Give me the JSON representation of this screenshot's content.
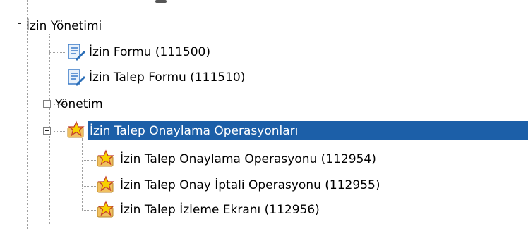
{
  "tree": {
    "root": {
      "label": "İzin Yönetimi",
      "icon": "collapse-icon",
      "children": [
        {
          "label": "İzin Formu (111500)",
          "icon": "form-edit-icon"
        },
        {
          "label": "İzin Talep Formu (111510)",
          "icon": "form-edit-icon"
        },
        {
          "label": "Yönetim",
          "icon": "expand-icon"
        },
        {
          "label": "İzin Talep Onaylama Operasyonları",
          "icon": "star-folder-icon",
          "selected": true,
          "children": [
            {
              "label": "İzin Talep Onaylama Operasyonu (112954)",
              "icon": "star-folder-icon"
            },
            {
              "label": "İzin Talep Onay İptali Operasyonu (112955)",
              "icon": "star-folder-icon"
            },
            {
              "label": "İzin Talep İzleme Ekranı (112956)",
              "icon": "star-folder-icon"
            }
          ]
        }
      ]
    }
  },
  "colors": {
    "selection": "#1c5fa8",
    "selected_text": "#ffffff",
    "connector": "#a0a0a0"
  }
}
